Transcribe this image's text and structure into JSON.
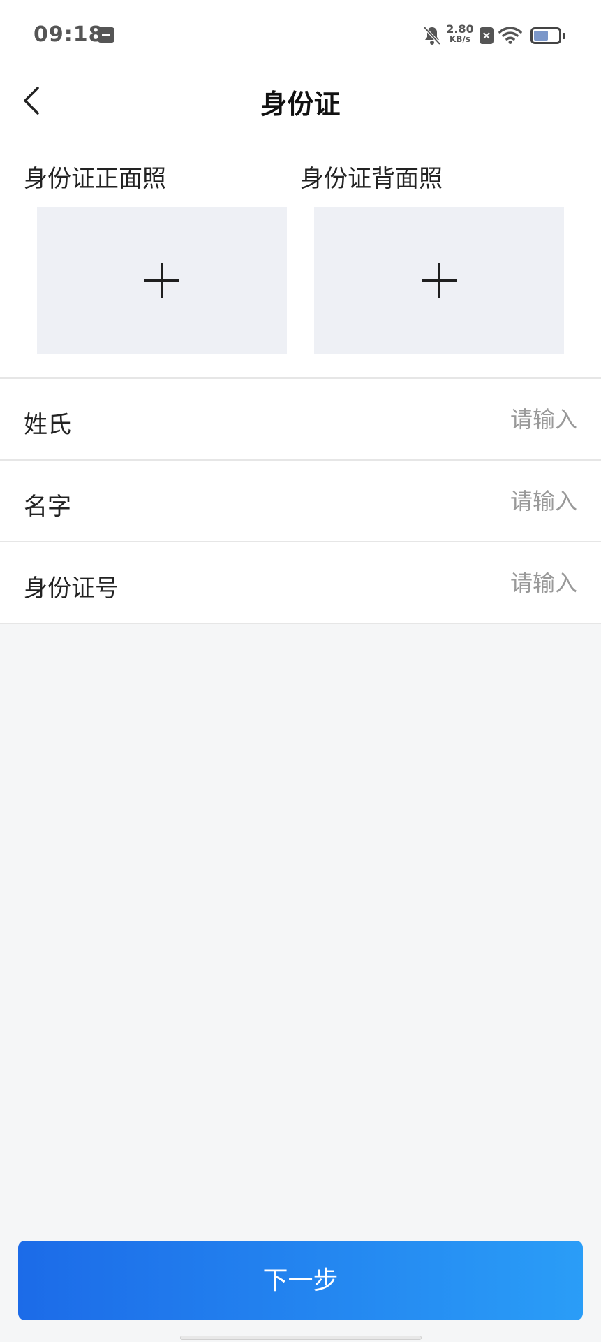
{
  "status_bar": {
    "time": "09:18",
    "net_speed": "2.80",
    "net_speed_unit": "KB/s",
    "battery_level": 0.6
  },
  "header": {
    "title": "身份证"
  },
  "photos": {
    "front_label": "身份证正面照",
    "back_label": "身份证背面照"
  },
  "form": {
    "rows": [
      {
        "label": "姓氏",
        "placeholder": "请输入"
      },
      {
        "label": "名字",
        "placeholder": "请输入"
      },
      {
        "label": "身份证号",
        "placeholder": "请输入"
      }
    ]
  },
  "footer": {
    "next_label": "下一步"
  },
  "colors": {
    "accent_start": "#1c6be8",
    "accent_end": "#2a9df7",
    "upload_bg": "#eef0f5"
  }
}
